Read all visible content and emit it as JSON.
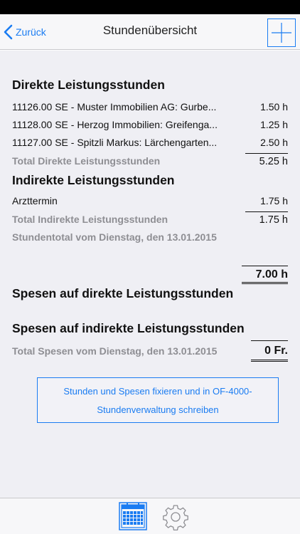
{
  "nav": {
    "back_label": "Zurück",
    "title": "Stundenübersicht"
  },
  "direct": {
    "title": "Direkte Leistungsstunden",
    "rows": [
      {
        "desc": "11126.00 SE - Muster Immobilien AG: Gurbe...",
        "hours": "1.50 h"
      },
      {
        "desc": "11128.00 SE - Herzog Immobilien: Greifenga...",
        "hours": "1.25 h"
      },
      {
        "desc": "11127.00 SE - Spitzli Markus: Lärchengarten...",
        "hours": "2.50 h"
      }
    ],
    "total_label": "Total Direkte Leistungsstunden",
    "total_value": "5.25 h"
  },
  "indirect": {
    "title": "Indirekte Leistungsstunden",
    "rows": [
      {
        "desc": "Arzttermin",
        "hours": "1.75 h"
      }
    ],
    "total_label": "Total Indirekte Leistungsstunden",
    "total_value": "1.75 h"
  },
  "day_total": {
    "label": "Stundentotal vom Dienstag, den 13.01.2015",
    "value": "7.00 h"
  },
  "spesen": {
    "direct_title": "Spesen auf direkte Leistungsstunden",
    "indirect_title": "Spesen auf indirekte Leistungsstunden",
    "total_label": "Total Spesen vom Dienstag, den 13.01.2015",
    "total_value": "0 Fr."
  },
  "action": {
    "line1": "Stunden und Spesen fixieren und in OF-4000-",
    "line2": "Stundenverwaltung schreiben"
  },
  "tabs": {
    "icons": [
      "calendar-icon",
      "gear-icon"
    ]
  },
  "colors": {
    "accent": "#1a7cf2",
    "background": "#efeff4",
    "muted_text": "#8e8e93"
  }
}
